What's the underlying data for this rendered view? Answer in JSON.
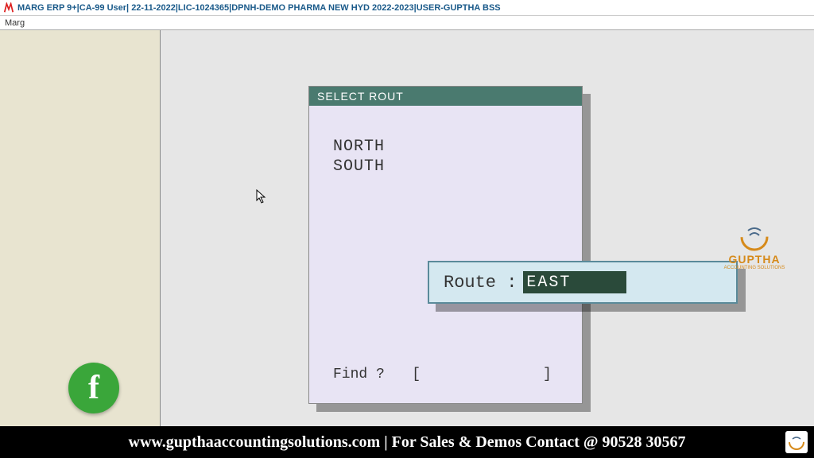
{
  "window": {
    "title": "MARG ERP 9+|CA-99 User| 22-11-2022|LIC-1024365|DPNH-DEMO PHARMA NEW HYD 2022-2023|USER-GUPTHA BSS"
  },
  "menu": {
    "label": "Marg"
  },
  "dialog": {
    "title": "SELECT ROUT",
    "routes": [
      "NORTH",
      "SOUTH"
    ],
    "find_label": "Find ?",
    "find_value": ""
  },
  "route_input": {
    "label": "Route :",
    "value": "EAST"
  },
  "watermark": {
    "name": "GUPTHA",
    "sub": "ACCOUNTING SOLUTIONS"
  },
  "footer": {
    "text": "www.gupthaaccountingsolutions.com | For Sales & Demos Contact @ 90528 30567"
  },
  "social": {
    "fb": "f"
  }
}
